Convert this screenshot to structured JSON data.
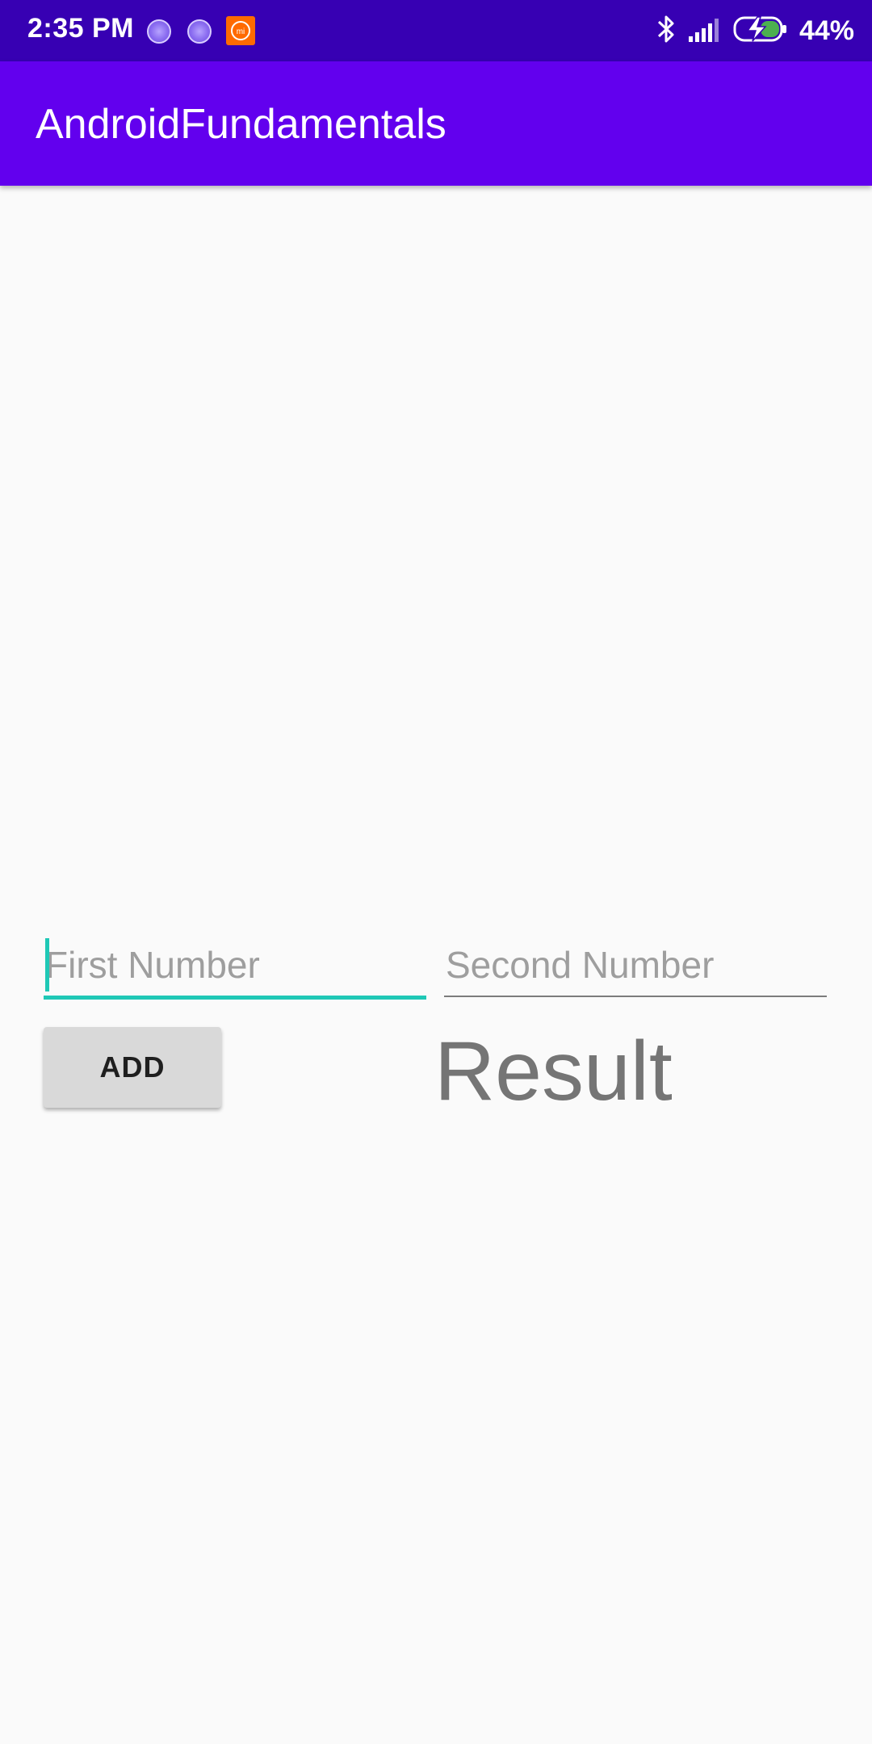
{
  "status_bar": {
    "time": "2:35 PM",
    "battery_percent": "44%",
    "battery_level": 0.44,
    "icons": [
      "notification-dot-icon",
      "notification-dot-icon",
      "mi-app-icon",
      "bluetooth-icon",
      "signal-icon",
      "battery-charging-icon"
    ],
    "background_color": "#3700b3"
  },
  "app_bar": {
    "title": "AndroidFundamentals",
    "background_color": "#6200ee"
  },
  "form": {
    "first_number": {
      "placeholder": "First Number",
      "value": "",
      "focused": true,
      "accent_color": "#1fc8b6"
    },
    "second_number": {
      "placeholder": "Second Number",
      "value": ""
    },
    "add_button_label": "ADD",
    "result_text": "Result"
  }
}
